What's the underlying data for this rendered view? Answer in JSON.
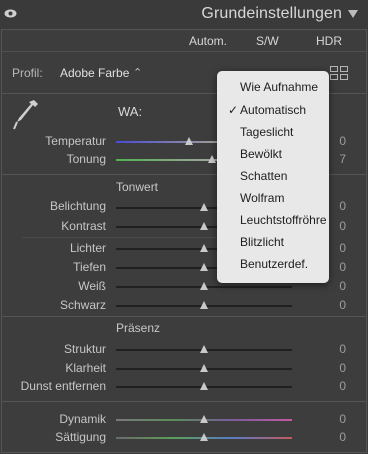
{
  "panel": {
    "title": "Grundeinstellungen",
    "modes": [
      "Autom.",
      "S/W",
      "HDR"
    ]
  },
  "profile": {
    "label": "Profil:",
    "value": "Adobe Farbe",
    "chevron": "⌃"
  },
  "wb": {
    "label": "WA:",
    "temperatur_label": "Temperatur",
    "tonung_label": "Tonung",
    "temperatur_value": "0",
    "tonung_value": "7"
  },
  "tonwert": {
    "section": "Tonwert",
    "rows": [
      {
        "label": "Belichtung",
        "value": "0"
      },
      {
        "label": "Kontrast",
        "value": "0"
      },
      {
        "label": "Lichter",
        "value": "0"
      },
      {
        "label": "Tiefen",
        "value": "0"
      },
      {
        "label": "Weiß",
        "value": "0"
      },
      {
        "label": "Schwarz",
        "value": "0"
      }
    ]
  },
  "praesenz": {
    "section": "Präsenz",
    "rows": [
      {
        "label": "Struktur",
        "value": "0"
      },
      {
        "label": "Klarheit",
        "value": "0"
      },
      {
        "label": "Dunst entfernen",
        "value": "0"
      }
    ]
  },
  "farbe": {
    "rows": [
      {
        "label": "Dynamik",
        "value": "0"
      },
      {
        "label": "Sättigung",
        "value": "0"
      }
    ]
  },
  "dropdown": {
    "items": [
      "Wie Aufnahme",
      "Automatisch",
      "Tageslicht",
      "Bewölkt",
      "Schatten",
      "Wolfram",
      "Leuchtstoffröhre",
      "Blitzlicht",
      "Benutzerdef."
    ],
    "selected": "Automatisch",
    "check": "✓"
  },
  "icons": [
    "eye-icon",
    "collapse-triangle-icon",
    "grid-icon",
    "eyedropper-icon"
  ]
}
